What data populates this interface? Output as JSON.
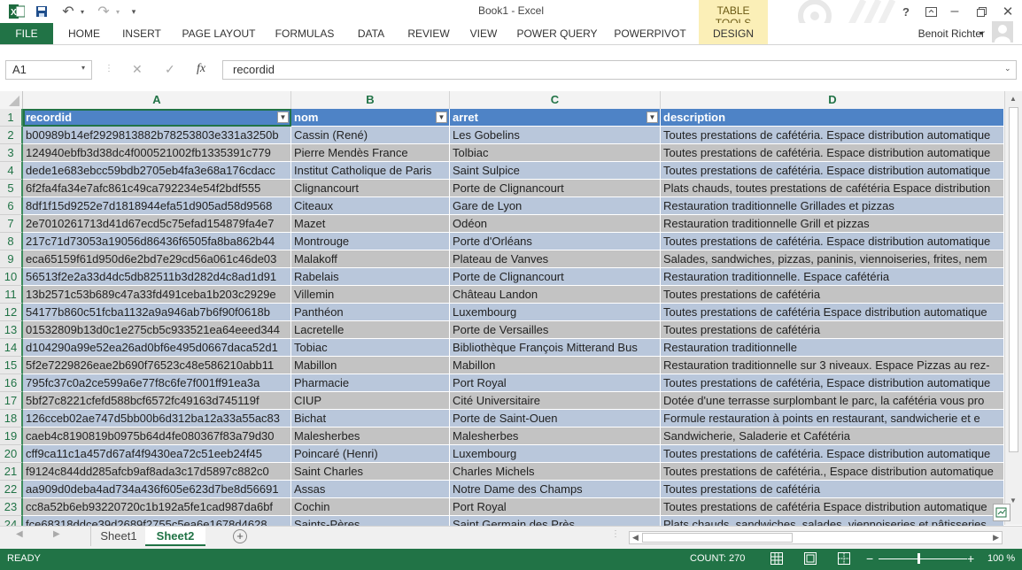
{
  "window": {
    "title": "Book1 - Excel",
    "user": "Benoit Richter"
  },
  "ribbon": {
    "file": "FILE",
    "tabs": [
      "HOME",
      "INSERT",
      "PAGE LAYOUT",
      "FORMULAS",
      "DATA",
      "REVIEW",
      "VIEW",
      "POWER QUERY",
      "POWERPIVOT"
    ],
    "context_group": "TABLE TOOLS",
    "context_tab": "DESIGN"
  },
  "formula_bar": {
    "name_box": "A1",
    "fx": "fx",
    "content": "recordid"
  },
  "columns": [
    "A",
    "B",
    "C",
    "D"
  ],
  "table": {
    "headers": [
      "recordid",
      "nom",
      "arret",
      "description"
    ],
    "rows": [
      [
        "b00989b14ef2929813882b78253803e331a3250b",
        "Cassin (René)",
        "Les Gobelins",
        "Toutes prestations de cafétéria. Espace distribution automatique"
      ],
      [
        "124940ebfb3d38dc4f000521002fb1335391c779",
        "Pierre Mendès France",
        "Tolbiac",
        "Toutes prestations de cafétéria. Espace distribution automatique"
      ],
      [
        "dede1e683ebcc59bdb2705eb4fa3e68a176cdacc",
        "Institut Catholique de Paris",
        "Saint Sulpice",
        "Toutes prestations de cafétéria. Espace distribution automatique"
      ],
      [
        "6f2fa4fa34e7afc861c49ca792234e54f2bdf555",
        "Clignancourt",
        "Porte de Clignancourt",
        "Plats chauds, toutes prestations de cafétéria Espace distribution"
      ],
      [
        "8df1f15d9252e7d1818944efa51d905ad58d9568",
        "Citeaux",
        "Gare de Lyon",
        "Restauration traditionnelle Grillades et pizzas"
      ],
      [
        "2e7010261713d41d67ecd5c75efad154879fa4e7",
        "Mazet",
        "Odéon",
        "Restauration traditionnelle Grill et pizzas"
      ],
      [
        "217c71d73053a19056d86436f6505fa8ba862b44",
        "Montrouge",
        "Porte d'Orléans",
        "Toutes prestations de cafétéria. Espace distribution automatique"
      ],
      [
        "eca65159f61d950d6e2bd7e29cd56a061c46de03",
        "Malakoff",
        "Plateau de Vanves",
        "Salades, sandwiches, pizzas, paninis, viennoiseries, frites, nem"
      ],
      [
        "56513f2e2a33d4dc5db82511b3d282d4c8ad1d91",
        "Rabelais",
        "Porte de Clignancourt",
        "Restauration traditionnelle. Espace cafétéria"
      ],
      [
        "13b2571c53b689c47a33fd491ceba1b203c2929e",
        "Villemin",
        "Château Landon",
        "Toutes prestations de cafétéria"
      ],
      [
        "54177b860c51fcba1132a9a946ab7b6f90f0618b",
        "Panthéon",
        "Luxembourg",
        "Toutes prestations de cafétéria Espace distribution automatique"
      ],
      [
        "01532809b13d0c1e275cb5c933521ea64eeed344",
        "Lacretelle",
        "Porte de Versailles",
        "Toutes prestations de cafétéria"
      ],
      [
        "d104290a99e52ea26ad0bf6e495d0667daca52d1",
        "Tobiac",
        "Bibliothèque François Mitterand Bus",
        "Restauration traditionnelle"
      ],
      [
        "5f2e7229826eae2b690f76523c48e586210abb11",
        "Mabillon",
        "Mabillon",
        "Restauration traditionnelle sur 3 niveaux. Espace Pizzas au rez-"
      ],
      [
        "795fc37c0a2ce599a6e77f8c6fe7f001ff91ea3a",
        "Pharmacie",
        "Port Royal",
        "Toutes prestations de cafétéria, Espace distribution automatique"
      ],
      [
        "5bf27c8221cfefd588bcf6572fc49163d745119f",
        "CIUP",
        "Cité Universitaire",
        "Dotée d'une terrasse surplombant le parc, la cafétéria vous pro"
      ],
      [
        "126cceb02ae747d5bb00b6d312ba12a33a55ac83",
        "Bichat",
        "Porte de Saint-Ouen",
        "Formule restauration à points en restaurant, sandwicherie et e"
      ],
      [
        "caeb4c8190819b0975b64d4fe080367f83a79d30",
        "Malesherbes",
        "Malesherbes",
        "Sandwicherie, Saladerie et Cafétéria"
      ],
      [
        "cff9ca11c1a457d67af4f9430ea72c51eeb24f45",
        "Poincaré (Henri)",
        "Luxembourg",
        "Toutes prestations de cafétéria.  Espace distribution automatique"
      ],
      [
        "f9124c844dd285afcb9af8ada3c17d5897c882c0",
        "Saint Charles",
        "Charles Michels",
        "Toutes prestations de cafétéria., Espace distribution automatique"
      ],
      [
        "aa909d0deba4ad734a436f605e623d7be8d56691",
        "Assas",
        "Notre Dame des Champs",
        "Toutes prestations de cafétéria"
      ],
      [
        "cc8a52b6eb93220720c1b192a5fe1cad987da6bf",
        "Cochin",
        "Port Royal",
        "Toutes prestations de cafétéria Espace distribution automatique"
      ],
      [
        "fce68318ddce39d2689f2755c5ea6e1678d4628",
        "Saints-Pères",
        "Saint Germain des Près",
        "Plats chauds, sandwiches, salades, viennoiseries et pâtisseries"
      ]
    ]
  },
  "sheets": [
    "Sheet1",
    "Sheet2"
  ],
  "active_sheet": "Sheet2",
  "status": {
    "ready": "READY",
    "count": "COUNT: 270",
    "zoom": "100 %"
  }
}
